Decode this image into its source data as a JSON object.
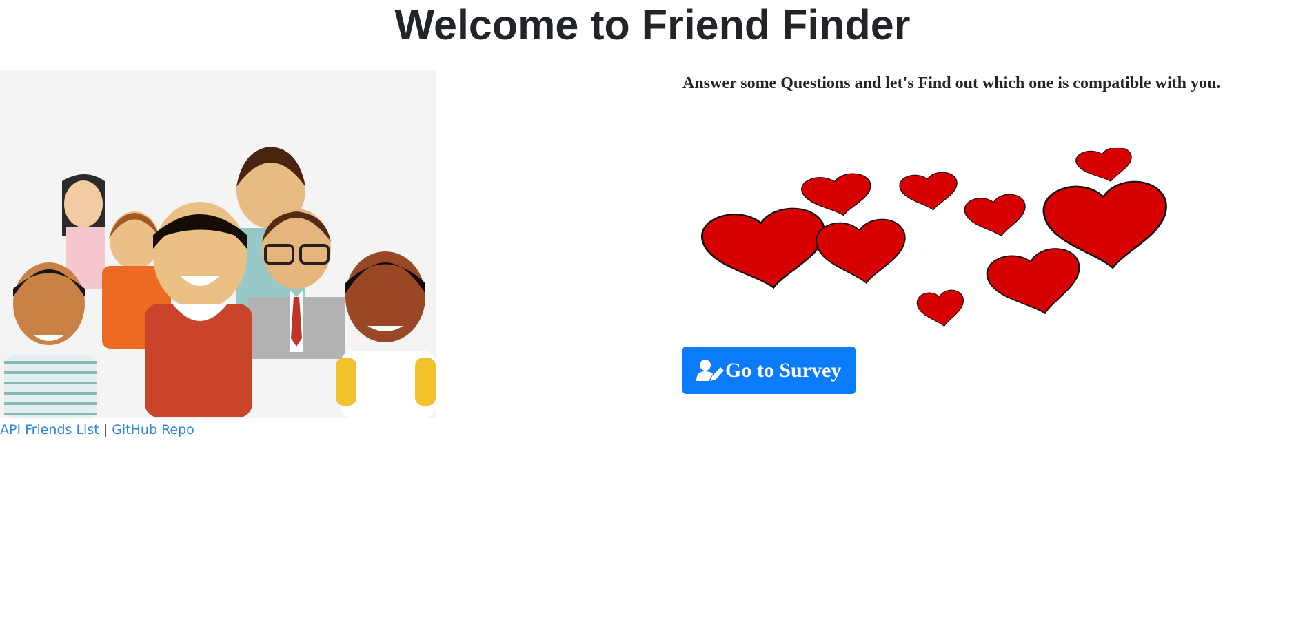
{
  "header": {
    "title": "Welcome to Friend Finder"
  },
  "hero": {
    "image_icon": "group-of-people-illustration",
    "tagline": "Answer some Questions and let's Find out which one is compatible with you.",
    "hearts_icon": "hearts-illustration"
  },
  "survey_button": {
    "label": "Go to Survey",
    "icon": "user-edit-icon"
  },
  "footer": {
    "api_link": "API Friends List",
    "separator": "|",
    "github_link": "GitHub Repo"
  },
  "colors": {
    "primary": "#0a7bfb",
    "link": "#2b87e0",
    "text": "#212529",
    "heart": "#d60000"
  }
}
